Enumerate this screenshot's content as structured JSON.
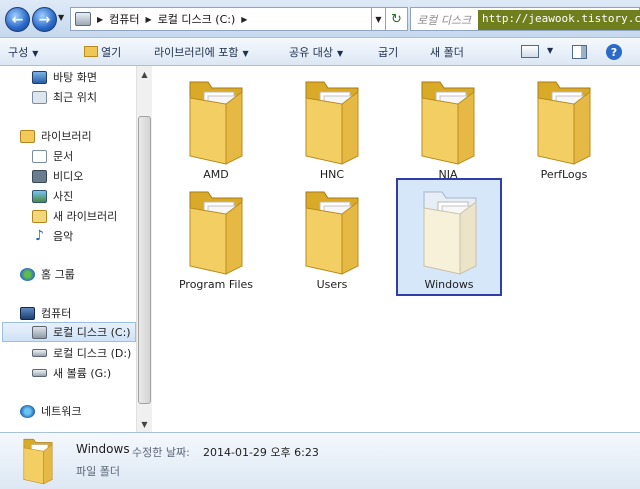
{
  "address": {
    "breadcrumb": [
      "컴퓨터",
      "로컬 디스크 (C:)"
    ],
    "search_placeholder": "로컬 디스크",
    "watermark": "http://jeawook.tistory.com"
  },
  "toolbar": {
    "organize": "구성",
    "open": "열기",
    "include_library": "라이브러리에 포함",
    "share_with": "공유 대상",
    "burn": "굽기",
    "new_folder": "새 폴더",
    "help": "?"
  },
  "nav": {
    "favorites": [
      {
        "label": "바탕 화면",
        "icon": "desktop-icon"
      },
      {
        "label": "최근 위치",
        "icon": "recent-places-icon"
      }
    ],
    "libraries": {
      "label": "라이브러리",
      "items": [
        {
          "label": "문서",
          "icon": "documents-icon"
        },
        {
          "label": "비디오",
          "icon": "videos-icon"
        },
        {
          "label": "사진",
          "icon": "pictures-icon"
        },
        {
          "label": "새 라이브러리",
          "icon": "new-library-icon"
        },
        {
          "label": "음악",
          "icon": "music-icon"
        }
      ]
    },
    "homegroup": "홈 그룹",
    "computer": {
      "label": "컴퓨터",
      "drives": [
        {
          "label": "로컬 디스크 (C:)",
          "selected": true
        },
        {
          "label": "로컬 디스크 (D:)",
          "selected": false
        },
        {
          "label": "새 볼륨 (G:)",
          "selected": false
        }
      ]
    },
    "network": "네트워크"
  },
  "folders": [
    {
      "name": "AMD",
      "selected": false
    },
    {
      "name": "HNC",
      "selected": false
    },
    {
      "name": "NIA",
      "selected": false
    },
    {
      "name": "PerfLogs",
      "selected": false
    },
    {
      "name": "Program Files",
      "selected": false
    },
    {
      "name": "Users",
      "selected": false
    },
    {
      "name": "Windows",
      "selected": true
    }
  ],
  "details": {
    "name": "Windows",
    "modified_label": "수정한 날짜:",
    "modified_value": "2014-01-29 오후 6:23",
    "type": "파일 폴더"
  },
  "colors": {
    "folder_yellow": "#f3cf63",
    "selection_border": "#2f3ea8",
    "selection_fill": "#d6e7fa"
  }
}
